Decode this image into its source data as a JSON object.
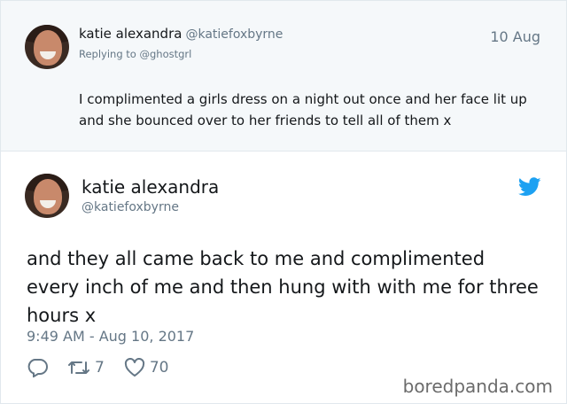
{
  "reply_tweet": {
    "author_name": "katie alexandra",
    "author_handle": "@katiefoxbyrne",
    "date": "10 Aug",
    "replying_to": "Replying to @ghostgrl",
    "text": "I complimented a girls dress on a night out once and her face lit up and she bounced over to her friends to tell all of them x"
  },
  "main_tweet": {
    "author_name": "katie alexandra",
    "author_handle": "@katiefoxbyrne",
    "text": "and they all came back to me and complimented every inch of me and then hung with with me for three hours x",
    "timestamp": "9:49 AM - Aug 10, 2017",
    "retweet_count": "7",
    "like_count": "70",
    "icons": {
      "reply": "reply-icon",
      "retweet": "retweet-icon",
      "like": "heart-icon",
      "brand": "twitter-bird-icon"
    },
    "colors": {
      "brand": "#1da1f2",
      "muted": "#657786",
      "reply_bg": "#f5f8fa"
    }
  },
  "watermark": "boredpanda.com"
}
